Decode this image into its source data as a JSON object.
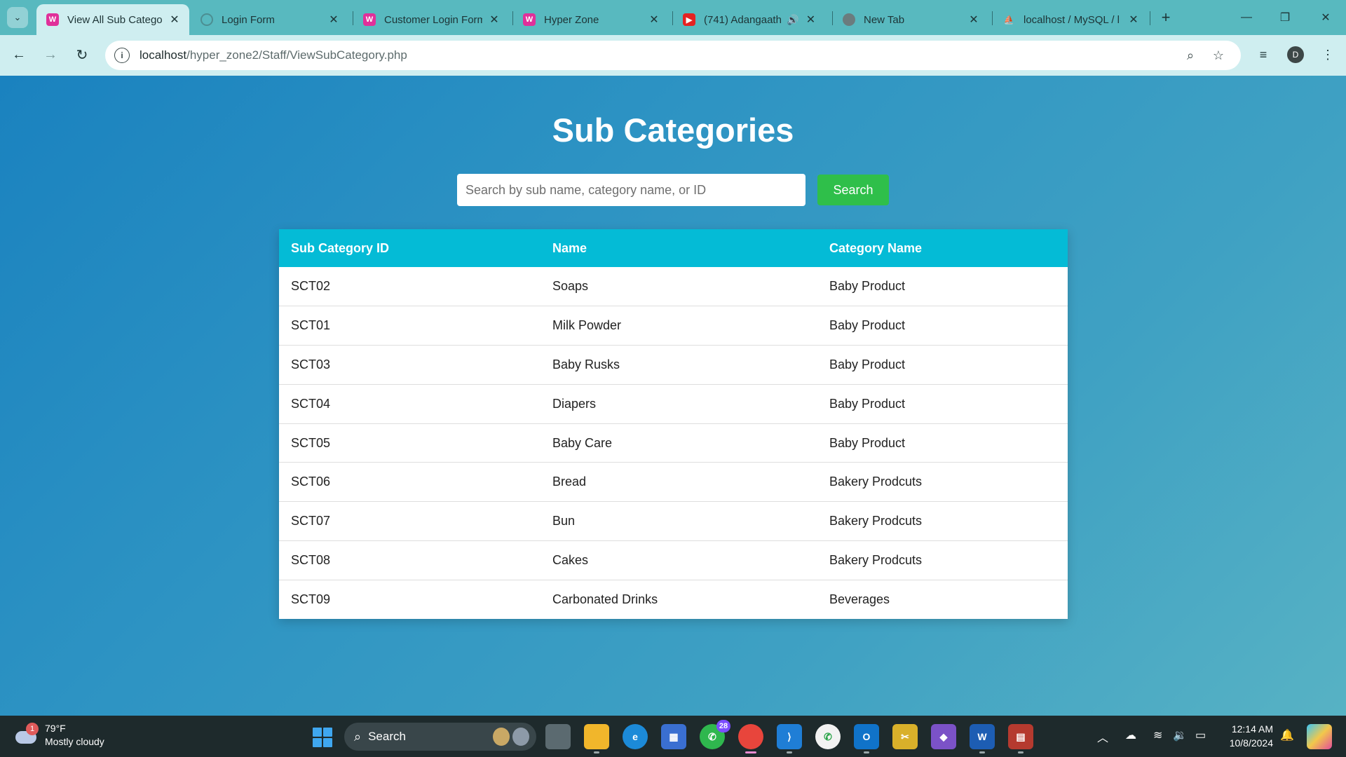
{
  "browser": {
    "tabs": [
      {
        "title": "View All Sub Categor",
        "favicon": "w-icon",
        "active": true
      },
      {
        "title": "Login Form",
        "favicon": "loading-icon"
      },
      {
        "title": "Customer Login Form",
        "favicon": "w-icon"
      },
      {
        "title": "Hyper Zone",
        "favicon": "w-icon"
      },
      {
        "title": "(741) Adangaath",
        "favicon": "youtube-icon"
      },
      {
        "title": "New Tab",
        "favicon": "chrome-icon"
      },
      {
        "title": "localhost / MySQL / l",
        "favicon": "phpmyadmin-icon"
      }
    ],
    "url_host": "localhost",
    "url_path": "/hyper_zone2/Staff/ViewSubCategory.php",
    "profile_initial": "D"
  },
  "page": {
    "title": "Sub Categories",
    "search": {
      "placeholder": "Search by sub name, category name, or ID",
      "value": "",
      "button_label": "Search"
    },
    "table": {
      "headers": [
        "Sub Category ID",
        "Name",
        "Category Name"
      ],
      "rows": [
        [
          "SCT02",
          "Soaps",
          "Baby Product"
        ],
        [
          "SCT01",
          "Milk Powder",
          "Baby Product"
        ],
        [
          "SCT03",
          "Baby Rusks",
          "Baby Product"
        ],
        [
          "SCT04",
          "Diapers",
          "Baby Product"
        ],
        [
          "SCT05",
          "Baby Care",
          "Baby Product"
        ],
        [
          "SCT06",
          "Bread",
          "Bakery Prodcuts"
        ],
        [
          "SCT07",
          "Bun",
          "Bakery Prodcuts"
        ],
        [
          "SCT08",
          "Cakes",
          "Bakery Prodcuts"
        ],
        [
          "SCT09",
          "Carbonated Drinks",
          "Beverages"
        ]
      ]
    },
    "colors": {
      "header_bg": "#04bbd6",
      "search_button": "#2fbf4a",
      "background": "#2a8fc2"
    }
  },
  "taskbar": {
    "weather_temp": "79°F",
    "weather_desc": "Mostly cloudy",
    "weather_badge": "1",
    "search_label": "Search",
    "whatsapp_badge": "28",
    "time": "12:14 AM",
    "date": "10/8/2024"
  }
}
